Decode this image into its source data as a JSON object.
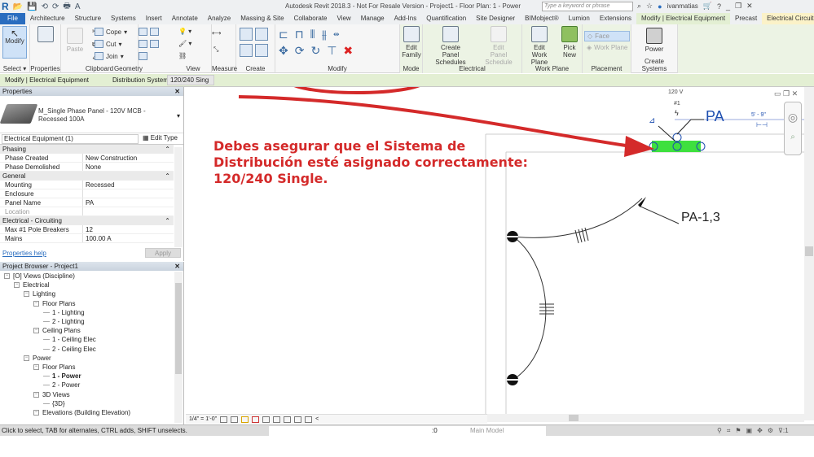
{
  "title_bar": {
    "app_title": "Autodesk Revit 2018.3 - Not For Resale Version -   Project1 - Floor Plan: 1 - Power",
    "search_placeholder": "Type a keyword or phrase",
    "username": "ivanmatias",
    "help": "?",
    "min": "_",
    "restore": "❐",
    "close": "✕"
  },
  "quick_access": [
    "R",
    "📂",
    "💾",
    "⟲",
    "⟳",
    "🖶",
    "A"
  ],
  "tabs": [
    {
      "label": "File"
    },
    {
      "label": "Architecture"
    },
    {
      "label": "Structure"
    },
    {
      "label": "Systems"
    },
    {
      "label": "Insert"
    },
    {
      "label": "Annotate"
    },
    {
      "label": "Analyze"
    },
    {
      "label": "Massing & Site"
    },
    {
      "label": "Collaborate"
    },
    {
      "label": "View"
    },
    {
      "label": "Manage"
    },
    {
      "label": "Add-Ins"
    },
    {
      "label": "Quantification"
    },
    {
      "label": "Site Designer"
    },
    {
      "label": "BIMobject®"
    },
    {
      "label": "Lumion"
    },
    {
      "label": "Extensions"
    },
    {
      "label": "Modify | Electrical Equipment"
    },
    {
      "label": "Precast"
    },
    {
      "label": "Electrical Circuits"
    }
  ],
  "ribbon": {
    "select": {
      "modify": "Modify",
      "label": "Select ▾"
    },
    "properties": {
      "label": "Properties"
    },
    "clipboard": {
      "paste": "Paste",
      "label": "Clipboard"
    },
    "geometry": {
      "cope": "Cope",
      "cut": "Cut",
      "join": "Join",
      "label": "Geometry"
    },
    "view": {
      "label": "View"
    },
    "measure": {
      "label": "Measure"
    },
    "create": {
      "label": "Create"
    },
    "modify": {
      "label": "Modify"
    },
    "mode": {
      "edit_family_1": "Edit",
      "edit_family_2": "Family",
      "label": "Mode"
    },
    "electrical": {
      "create_1": "Create",
      "create_2": "Panel Schedules",
      "edit_1": "Edit",
      "edit_2": "Panel Schedule",
      "label": "Electrical"
    },
    "work_plane": {
      "edit_1": "Edit",
      "edit_2": "Work Plane",
      "pick_1": "Pick",
      "pick_2": "New",
      "label": "Work Plane"
    },
    "placement": {
      "face": "Face",
      "work_plane": "Work Plane",
      "label": "Placement"
    },
    "create_systems": {
      "power": "Power",
      "label": "Create Systems"
    }
  },
  "options_bar": {
    "context": "Modify | Electrical Equipment",
    "dist_label": "Distribution System:",
    "dist_value": "120/240 Sing ⌄"
  },
  "properties": {
    "header": "Properties",
    "type_name": "M_Single Phase Panel - 120V MCB - Recessed 100A",
    "filter": "Electrical Equipment (1)",
    "edit_type": "Edit Type",
    "sections": [
      {
        "name": "Phasing",
        "rows": [
          {
            "k": "Phase Created",
            "v": "New Construction"
          },
          {
            "k": "Phase Demolished",
            "v": "None"
          }
        ]
      },
      {
        "name": "General",
        "rows": [
          {
            "k": "Mounting",
            "v": "Recessed"
          },
          {
            "k": "Enclosure",
            "v": ""
          },
          {
            "k": "Panel Name",
            "v": "PA"
          },
          {
            "k": "Location",
            "v": ""
          }
        ]
      },
      {
        "name": "Electrical - Circuiting",
        "rows": [
          {
            "k": "Max #1 Pole Breakers",
            "v": "12"
          },
          {
            "k": "Mains",
            "v": "100.00 A"
          }
        ]
      }
    ],
    "help_link": "Properties help",
    "apply": "Apply"
  },
  "project_browser": {
    "header": "Project Browser - Project1",
    "nodes": [
      {
        "t": "[O] Views (Discipline)",
        "lvl": 0,
        "tg": "−"
      },
      {
        "t": "Electrical",
        "lvl": 1,
        "tg": "−"
      },
      {
        "t": "Lighting",
        "lvl": 2,
        "tg": "−"
      },
      {
        "t": "Floor Plans",
        "lvl": 3,
        "tg": "−"
      },
      {
        "t": "1 - Lighting",
        "lvl": 4
      },
      {
        "t": "2 - Lighting",
        "lvl": 4
      },
      {
        "t": "Ceiling Plans",
        "lvl": 3,
        "tg": "−"
      },
      {
        "t": "1 - Ceiling Elec",
        "lvl": 4
      },
      {
        "t": "2 - Ceiling Elec",
        "lvl": 4
      },
      {
        "t": "Power",
        "lvl": 2,
        "tg": "−"
      },
      {
        "t": "Floor Plans",
        "lvl": 3,
        "tg": "−"
      },
      {
        "t": "1 - Power",
        "lvl": 4,
        "bold": true
      },
      {
        "t": "2 - Power",
        "lvl": 4
      },
      {
        "t": "3D Views",
        "lvl": 3,
        "tg": "−"
      },
      {
        "t": "{3D}",
        "lvl": 4
      },
      {
        "t": "Elevations (Building Elevation)",
        "lvl": 3,
        "tg": "−"
      }
    ]
  },
  "canvas": {
    "annotation_line1": "Debes asegurar que el Sistema de",
    "annotation_line2": "Distribución esté asignado correctamente:",
    "annotation_line3": "120/240 Single.",
    "voltage": "120 V",
    "pole": "#1",
    "panel_tag": "PA",
    "dimension": "5' - 9\"",
    "circuit_tag": "PA-1,3",
    "accent_red": "#d42a2a",
    "panel_green": "#3ee03e",
    "tag_blue": "#1e4fb0"
  },
  "view_control": {
    "scale": "1/4\" = 1'-0\""
  },
  "status_bar": {
    "message": "Click to select, TAB for alternates, CTRL adds, SHIFT unselects.",
    "zero": ":0",
    "model": "Main Model",
    "filter_count": ":1"
  }
}
